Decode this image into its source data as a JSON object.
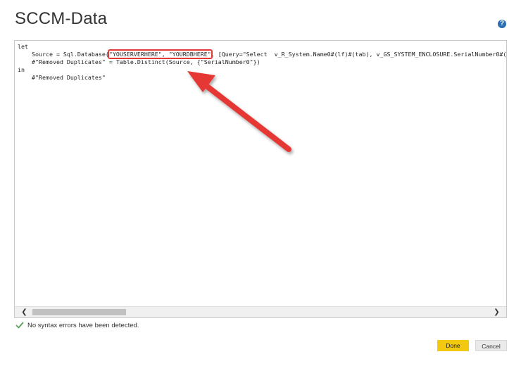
{
  "dialog": {
    "title": "SCCM-Data",
    "help_glyph": "?"
  },
  "editor": {
    "lines": [
      "let",
      "    Source = Sql.Database(",
      "\"YOUSERVERHERE\", \"YOURDBHERE\"",
      ", [Query=\"Select  v_R_System.Name0#(lf)#(tab), v_GS_SYSTEM_ENCLOSURE.SerialNumber0#(lf)#",
      "    #\"Removed Duplicates\" = Table.Distinct(Source, {\"SerialNumber0\"})",
      "in",
      "    #\"Removed Duplicates\""
    ]
  },
  "scrollbar": {
    "left_glyph": "❮",
    "right_glyph": "❯"
  },
  "status": {
    "message": "No syntax errors have been detected.",
    "icon": "checkmark-icon"
  },
  "buttons": {
    "done": "Done",
    "cancel": "Cancel"
  },
  "colors": {
    "highlight_box": "#e53935",
    "annotation_arrow": "#e53935",
    "done_button": "#f2c811",
    "help_icon": "#2b6fb6",
    "check_icon": "#5aa05a"
  }
}
